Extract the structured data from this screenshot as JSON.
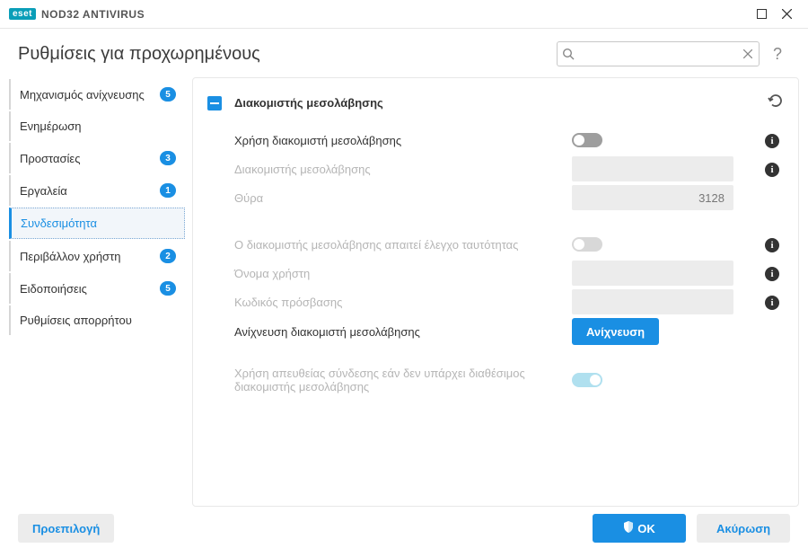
{
  "titlebar": {
    "logo": "eset",
    "product": "NOD32 ANTIVIRUS"
  },
  "header": {
    "title": "Ρυθμίσεις για προχωρημένους",
    "search_placeholder": ""
  },
  "sidebar": {
    "items": [
      {
        "label": "Μηχανισμός ανίχνευσης",
        "badge": "5",
        "active": false
      },
      {
        "label": "Ενημέρωση",
        "badge": null,
        "active": false
      },
      {
        "label": "Προστασίες",
        "badge": "3",
        "active": false
      },
      {
        "label": "Εργαλεία",
        "badge": "1",
        "active": false
      },
      {
        "label": "Συνδεσιμότητα",
        "badge": null,
        "active": true
      },
      {
        "label": "Περιβάλλον χρήστη",
        "badge": "2",
        "active": false
      },
      {
        "label": "Ειδοποιήσεις",
        "badge": "5",
        "active": false
      },
      {
        "label": "Ρυθμίσεις απορρήτου",
        "badge": null,
        "active": false
      }
    ]
  },
  "section": {
    "title": "Διακομιστής μεσολάβησης",
    "rows": {
      "use_proxy": {
        "label": "Χρήση διακομιστή μεσολάβησης"
      },
      "proxy_server": {
        "label": "Διακομιστής μεσολάβησης",
        "value": ""
      },
      "port": {
        "label": "Θύρα",
        "value": "3128"
      },
      "requires_auth": {
        "label": "Ο διακομιστής μεσολάβησης απαιτεί έλεγχο ταυτότητας"
      },
      "username": {
        "label": "Όνομα χρήστη",
        "value": ""
      },
      "password": {
        "label": "Κωδικός πρόσβασης",
        "value": ""
      },
      "detect": {
        "label": "Ανίχνευση διακομιστή μεσολάβησης",
        "button": "Ανίχνευση"
      },
      "direct_fallback": {
        "label": "Χρήση απευθείας σύνδεσης εάν δεν υπάρχει διαθέσιμος διακομιστής μεσολάβησης"
      }
    }
  },
  "footer": {
    "default": "Προεπιλογή",
    "ok": "OK",
    "cancel": "Ακύρωση"
  }
}
